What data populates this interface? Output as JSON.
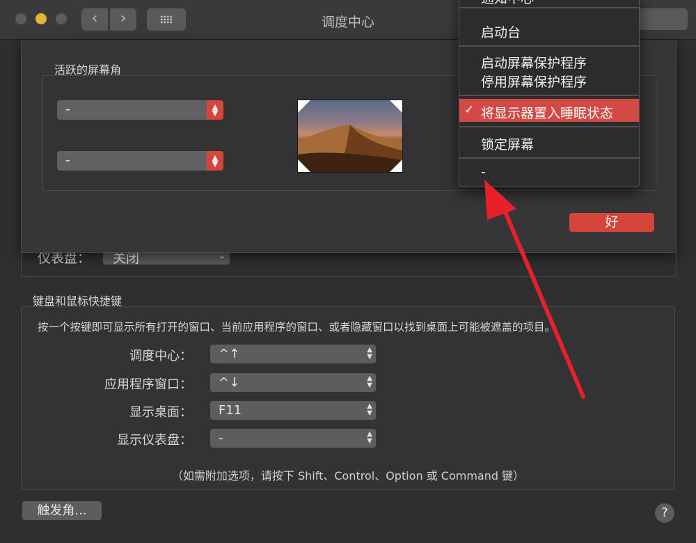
{
  "window": {
    "title": "调度中心"
  },
  "sheet": {
    "title": "活跃的屏幕角",
    "corner_top_left": "-",
    "corner_bottom_left": "-",
    "ok_label": "好"
  },
  "dashboard": {
    "label": "仪表盘：",
    "value": "关闭"
  },
  "menu": {
    "partial_top": "通知中心",
    "items": [
      "启动台",
      "启动屏幕保护程序",
      "停用屏幕保护程序",
      "将显示器置入睡眠状态",
      "锁定屏幕",
      "-"
    ],
    "checked_item": "将显示器置入睡眠状态"
  },
  "shortcuts": {
    "title": "键盘和鼠标快捷键",
    "description": "按一个按键即可显示所有打开的窗口、当前应用程序的窗口、或者隐藏窗口以找到桌面上可能被遮盖的项目。",
    "rows": [
      {
        "label": "调度中心：",
        "value": "^↑"
      },
      {
        "label": "应用程序窗口：",
        "value": "^↓"
      },
      {
        "label": "显示桌面：",
        "value": "F11"
      },
      {
        "label": "显示仪表盘：",
        "value": "-"
      }
    ],
    "note": "（如需附加选项，请按下 Shift、Control、Option 或 Command 键）"
  },
  "footer": {
    "hot_corners_button": "触发角...",
    "help_button": "?"
  },
  "colors": {
    "accent": "#d6443a",
    "annotation_arrow": "#e8202a"
  }
}
